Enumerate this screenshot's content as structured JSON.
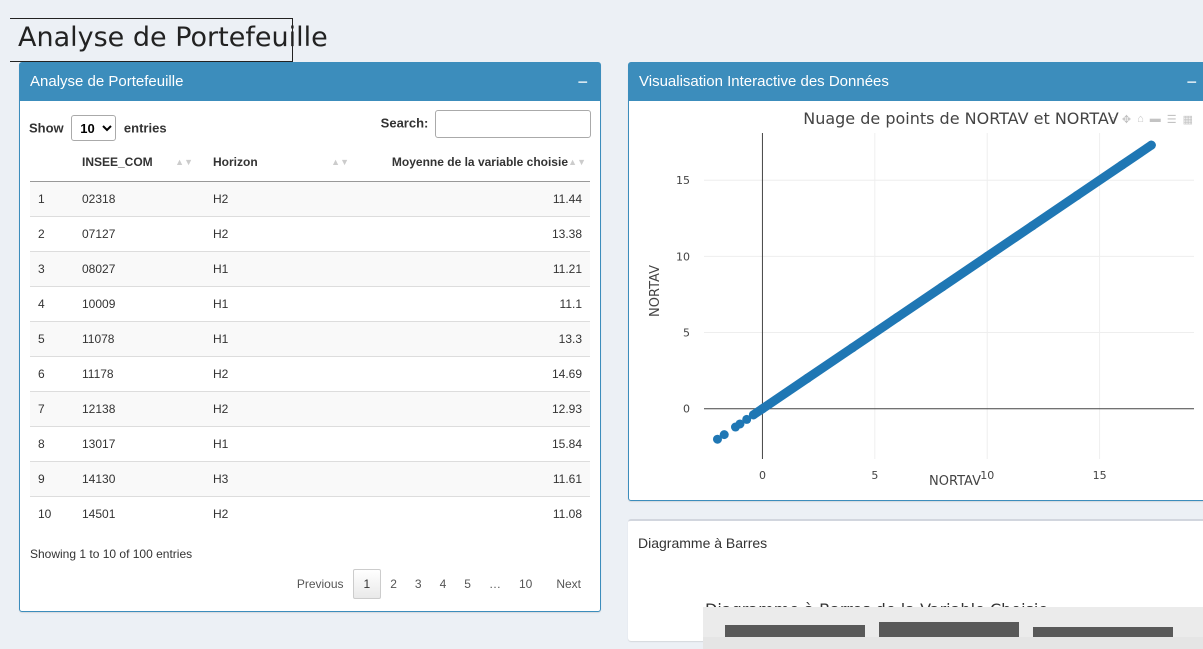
{
  "page": {
    "title": "Analyse de Portefeuille"
  },
  "table_box": {
    "header": "Analyse de Portefeuille",
    "collapse_glyph": "−",
    "show_label": "Show",
    "entries_label": "entries",
    "page_length": "10",
    "search_label": "Search:",
    "search_value": "",
    "columns": [
      "",
      "INSEE_COM",
      "Horizon",
      "Moyenne de la variable choisie"
    ],
    "rows": [
      [
        "1",
        "02318",
        "H2",
        "11.44"
      ],
      [
        "2",
        "07127",
        "H2",
        "13.38"
      ],
      [
        "3",
        "08027",
        "H1",
        "11.21"
      ],
      [
        "4",
        "10009",
        "H1",
        "11.1"
      ],
      [
        "5",
        "11078",
        "H1",
        "13.3"
      ],
      [
        "6",
        "11178",
        "H2",
        "14.69"
      ],
      [
        "7",
        "12138",
        "H2",
        "12.93"
      ],
      [
        "8",
        "13017",
        "H1",
        "15.84"
      ],
      [
        "9",
        "14130",
        "H3",
        "11.61"
      ],
      [
        "10",
        "14501",
        "H2",
        "11.08"
      ]
    ],
    "info": "Showing 1 to 10 of 100 entries",
    "pagination": {
      "previous": "Previous",
      "pages": [
        "1",
        "2",
        "3",
        "4",
        "5",
        "…",
        "10"
      ],
      "current": "1",
      "next": "Next"
    }
  },
  "scatter_box": {
    "header": "Visualisation Interactive des Données",
    "collapse_glyph": "−"
  },
  "bar_box": {
    "header": "Diagramme à Barres",
    "title": "Diagramme à Barres de la Variable Choisie"
  },
  "colors": {
    "primary": "#3c8dbc",
    "marker": "#1f77b4",
    "background": "#ecf0f5"
  },
  "chart_data": {
    "type": "scatter",
    "title": "Nuage de points de NORTAV et NORTAV",
    "xlabel": "NORTAV",
    "ylabel": "NORTAV",
    "xlim": [
      -2.6,
      19.2
    ],
    "ylim": [
      -3.3,
      18.1
    ],
    "x_ticks": [
      0,
      5,
      10,
      15
    ],
    "y_ticks": [
      0,
      5,
      10,
      15
    ],
    "grid": true,
    "series": [
      {
        "x": [
          -2.0,
          -1.7,
          -1.2,
          -1.0,
          -0.7,
          -0.4,
          0.0,
          2.0,
          4.0,
          6.0,
          8.0,
          10.0,
          12.0,
          14.0,
          16.0,
          17.3
        ],
        "y": [
          -2.0,
          -1.7,
          -1.2,
          -1.0,
          -0.7,
          -0.4,
          0.0,
          2.0,
          4.0,
          6.0,
          8.0,
          10.0,
          12.0,
          14.0,
          16.0,
          17.3
        ]
      }
    ]
  }
}
